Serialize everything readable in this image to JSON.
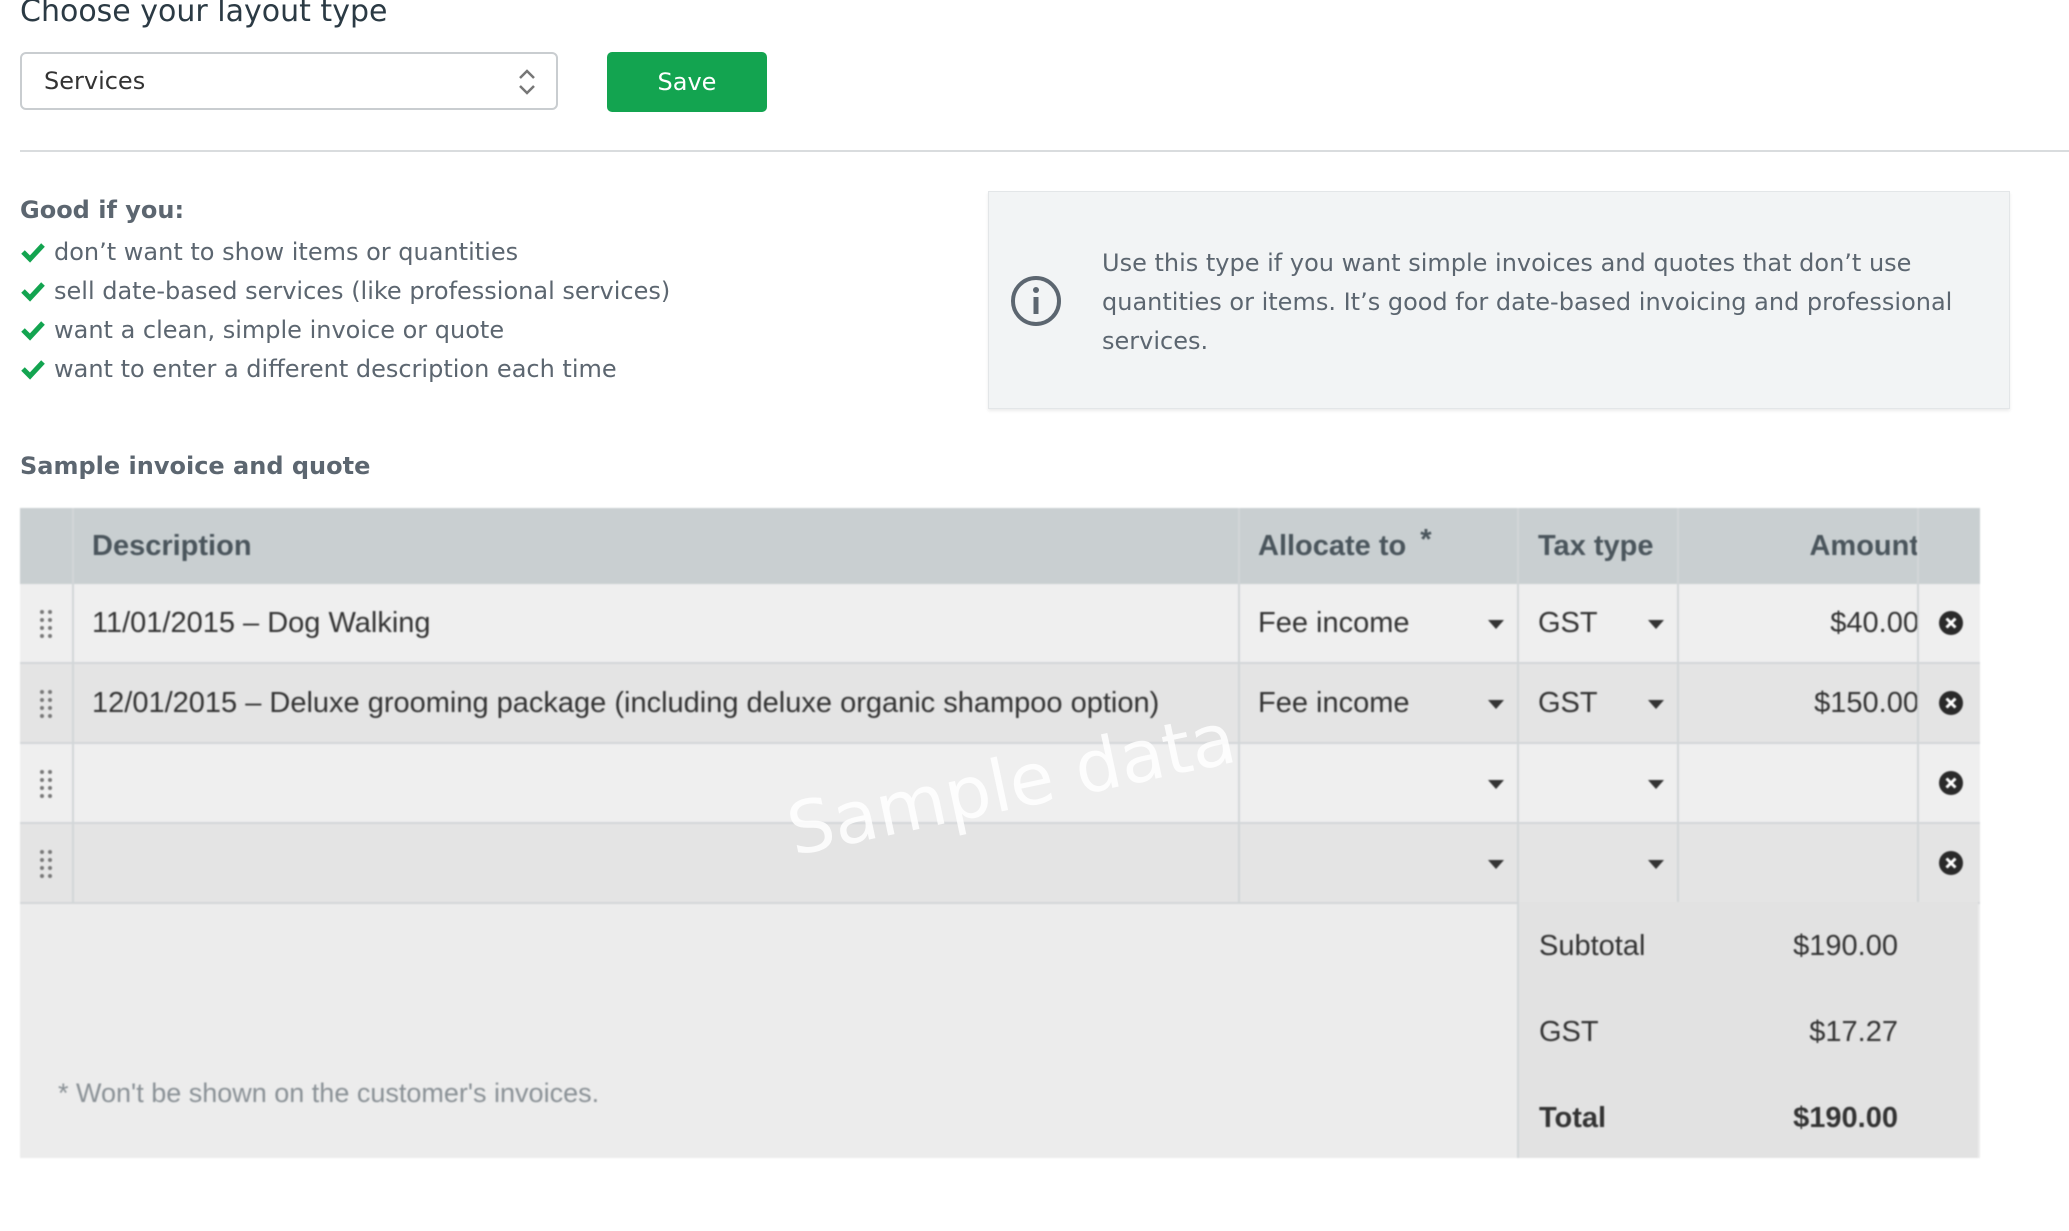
{
  "page": {
    "title": "Choose your layout type",
    "save_label": "Save"
  },
  "layout_select": {
    "value": "Services"
  },
  "good_if": {
    "heading": "Good if you:",
    "items": [
      "don’t want to show items or quantities",
      "sell date-based services (like professional services)",
      "want a clean, simple invoice or quote",
      "want to enter a different description each time"
    ]
  },
  "info": {
    "text": "Use this type if you want simple invoices and quotes that don’t use quantities or items. It’s good for date-based invoicing and professional services."
  },
  "sample": {
    "heading": "Sample invoice and quote",
    "watermark": "Sample data",
    "columns": {
      "description": "Description",
      "allocate": "Allocate to",
      "allocate_mark": "*",
      "tax": "Tax type",
      "amount": "Amount"
    },
    "rows": [
      {
        "description": "11/01/2015 – Dog Walking",
        "allocate": "Fee income",
        "tax": "GST",
        "amount": "$40.00"
      },
      {
        "description": "12/01/2015 – Deluxe grooming package (including deluxe organic shampoo option)",
        "allocate": "Fee income",
        "tax": "GST",
        "amount": "$150.00"
      },
      {
        "description": "",
        "allocate": "",
        "tax": "",
        "amount": ""
      },
      {
        "description": "",
        "allocate": "",
        "tax": "",
        "amount": ""
      }
    ],
    "totals": {
      "subtotal_label": "Subtotal",
      "subtotal_value": "$190.00",
      "gst_label": "GST",
      "gst_value": "$17.27",
      "total_label": "Total",
      "total_value": "$190.00"
    },
    "footnote": "* Won't be shown on the customer's invoices."
  },
  "colors": {
    "accent": "#13a450",
    "check": "#13a450"
  }
}
